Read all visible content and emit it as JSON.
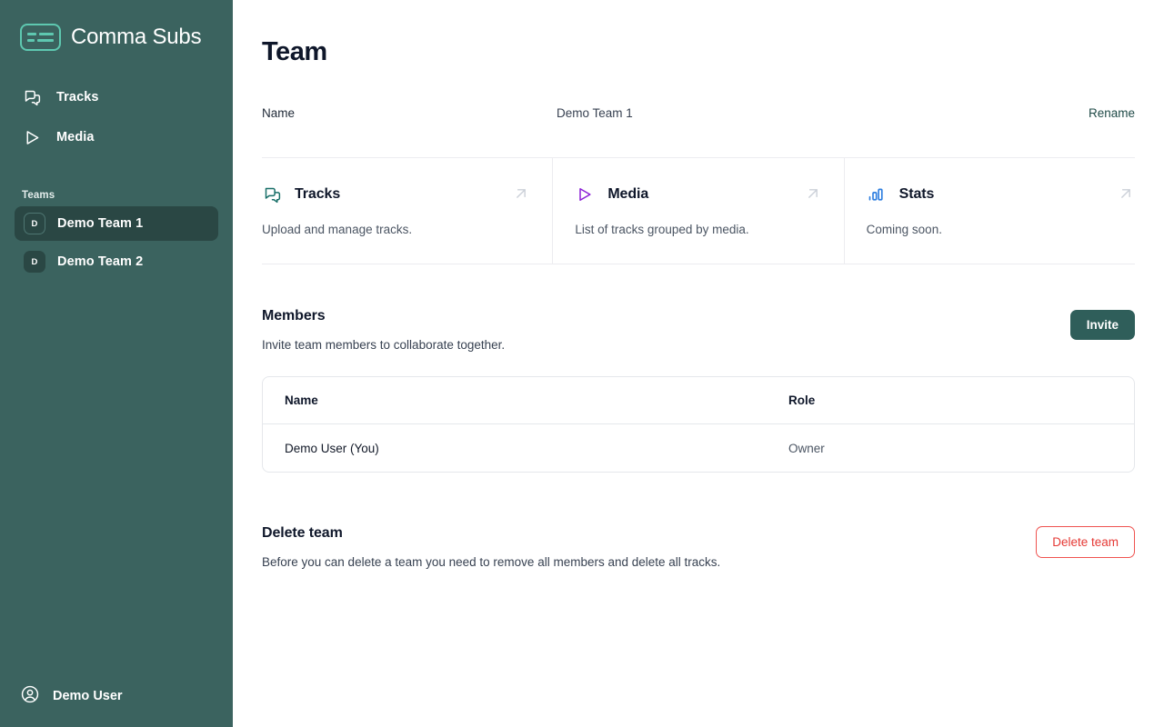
{
  "app": {
    "brand_name": "Comma Subs",
    "logo_icon": "captions-logo-icon",
    "accent_teal": "#5ec8b0",
    "sidebar_bg": "#3b635f"
  },
  "sidebar": {
    "nav": [
      {
        "label": "Tracks",
        "icon": "speech-bubbles-icon"
      },
      {
        "label": "Media",
        "icon": "play-triangle-icon"
      }
    ],
    "teams_label": "Teams",
    "teams": [
      {
        "avatar": "D",
        "label": "Demo Team 1",
        "active": true
      },
      {
        "avatar": "D",
        "label": "Demo Team 2",
        "active": false
      }
    ],
    "footer": {
      "user_name": "Demo User",
      "icon": "user-circle-icon"
    }
  },
  "main": {
    "page_title": "Team",
    "name_row": {
      "label": "Name",
      "value": "Demo Team 1",
      "rename_label": "Rename"
    },
    "cards": [
      {
        "title": "Tracks",
        "desc": "Upload and manage tracks.",
        "icon": "speech-bubbles-icon",
        "icon_color": "#186f68",
        "arrow_icon": "arrow-up-right-icon"
      },
      {
        "title": "Media",
        "desc": "List of tracks grouped by media.",
        "icon": "play-triangle-icon",
        "icon_color": "#8b1fd6",
        "arrow_icon": "arrow-up-right-icon"
      },
      {
        "title": "Stats",
        "desc": "Coming soon.",
        "icon": "bar-chart-icon",
        "icon_color": "#2f7fe0",
        "arrow_icon": "arrow-up-right-icon"
      }
    ],
    "members": {
      "title": "Members",
      "subtitle": "Invite team members to collaborate together.",
      "invite_label": "Invite",
      "invite_color": "#2f5e5a",
      "columns": [
        "Name",
        "Role"
      ],
      "rows": [
        {
          "name": "Demo User (You)",
          "role": "Owner"
        }
      ]
    },
    "delete": {
      "title": "Delete team",
      "subtitle": "Before you can delete a team you need to remove all members and delete all tracks.",
      "button_label": "Delete team",
      "button_color": "#e53935"
    }
  }
}
